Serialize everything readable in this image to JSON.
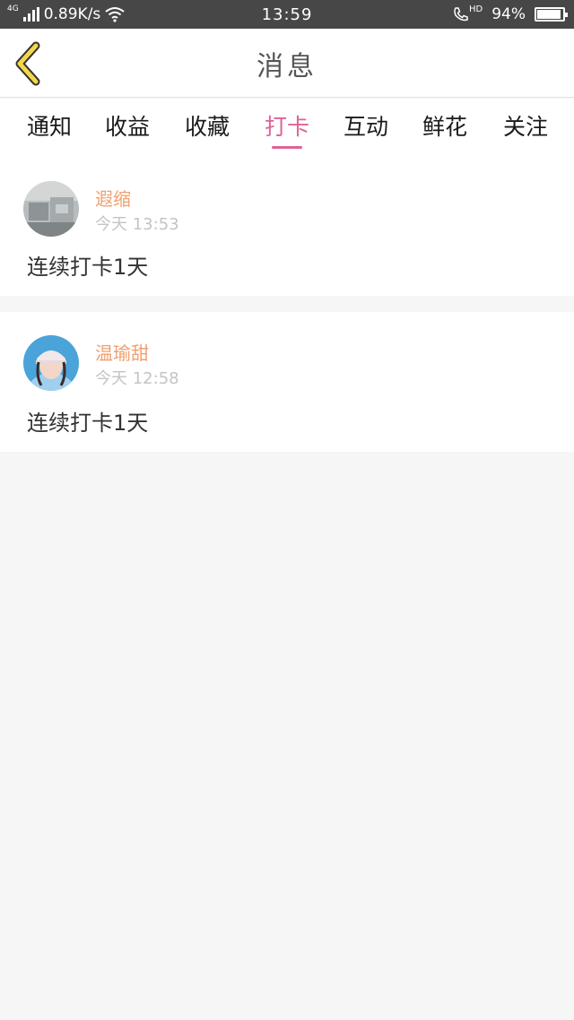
{
  "status_bar": {
    "network_type": "4G",
    "speed": "0.89K/s",
    "time": "13:59",
    "hd_label": "HD",
    "battery": "94%",
    "battery_level": 0.94
  },
  "header": {
    "title": "消息",
    "back_icon": "chevron-left-icon",
    "accent_color": "#f2d84a"
  },
  "tabs": [
    {
      "label": "通知",
      "active": false
    },
    {
      "label": "收益",
      "active": false
    },
    {
      "label": "收藏",
      "active": false
    },
    {
      "label": "打卡",
      "active": true
    },
    {
      "label": "互动",
      "active": false
    },
    {
      "label": "鲜花",
      "active": false
    },
    {
      "label": "关注",
      "active": false
    }
  ],
  "colors": {
    "active_tab": "#e0619a",
    "username": "#f0a070",
    "timestamp": "#c4c4c4"
  },
  "messages": [
    {
      "username": "遐缩",
      "time": "今天 13:53",
      "text": "连续打卡1天"
    },
    {
      "username": "温瑜甜",
      "time": "今天 12:58",
      "text": "连续打卡1天"
    }
  ]
}
